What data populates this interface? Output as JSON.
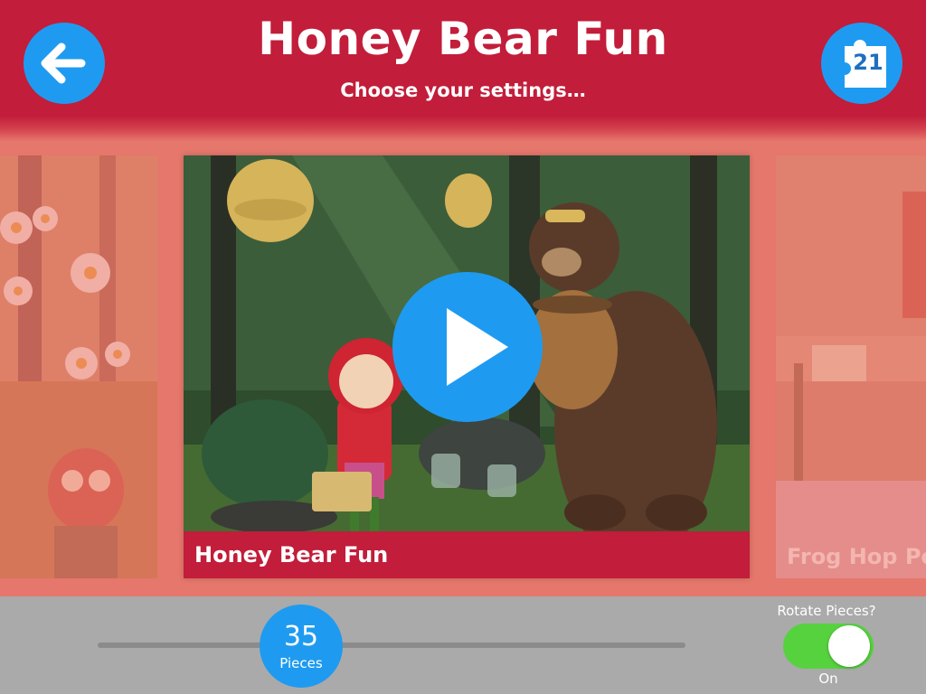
{
  "header": {
    "title": "Honey Bear Fun",
    "subtitle": "Choose your settings…",
    "back_icon": "arrow-left-icon",
    "puzzle_count": "21",
    "puzzle_icon": "puzzle-piece-icon"
  },
  "carousel": {
    "current": {
      "title": "Honey Bear Fun",
      "play_icon": "play-icon"
    },
    "previous": {
      "title": ""
    },
    "next": {
      "title": "Frog Hop Po"
    }
  },
  "settings": {
    "pieces": {
      "value": "35",
      "unit": "Pieces",
      "min_pct": 0,
      "max_pct": 100,
      "position_pct": 35
    },
    "rotate": {
      "label": "Rotate Pieces?",
      "state": "On",
      "enabled": true
    }
  },
  "colors": {
    "header": "#c21d3a",
    "accent": "#1e9bf0",
    "toggle_on": "#56d23e",
    "bottom_bar": "#aaaaaa"
  }
}
